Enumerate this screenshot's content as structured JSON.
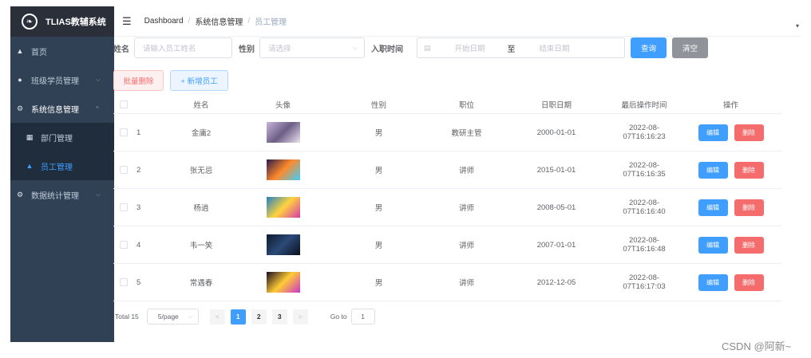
{
  "brand": {
    "title": "TLIAS教辅系统",
    "logo_icon": "leaf-logo"
  },
  "sidebar": {
    "items": [
      {
        "label": "首页",
        "icon": "home-icon",
        "glyph": "▲"
      },
      {
        "label": "班级学员管理",
        "icon": "settings-icon",
        "glyph": "●",
        "expandable": true
      },
      {
        "label": "系统信息管理",
        "icon": "gear-icon",
        "glyph": "⚙",
        "expandable": true,
        "open": true
      },
      {
        "label": "数据统计管理",
        "icon": "gear-icon",
        "glyph": "⚙",
        "expandable": true
      }
    ],
    "subitems": [
      {
        "label": "部门管理",
        "icon": "grid-icon",
        "glyph": "▦"
      },
      {
        "label": "员工管理",
        "icon": "user-icon",
        "glyph": "▲",
        "active": true
      }
    ],
    "chevron_down": "⌵",
    "chevron_up": "^"
  },
  "header": {
    "menu_glyph": "☰",
    "breadcrumb": [
      "Dashboard",
      "系统信息管理",
      "员工管理"
    ],
    "separator": "/",
    "caret": "▾"
  },
  "search": {
    "name_label": "姓名",
    "name_placeholder": "请输入员工姓名",
    "gender_label": "性别",
    "gender_placeholder": "请选择",
    "entry_label": "入职时间",
    "start_placeholder": "开始日期",
    "range_sep": "至",
    "end_placeholder": "结束日期",
    "query_button": "查询",
    "clear_button": "清空",
    "caret": "⌵",
    "calendar_glyph": "▤"
  },
  "actions": {
    "batch_delete": "批量删除",
    "add_employee": "+ 新增员工"
  },
  "table": {
    "headers": [
      "姓名",
      "头像",
      "性别",
      "职位",
      "日职日期",
      "最后操作时间",
      "操作"
    ],
    "rows": [
      {
        "index": "1",
        "name": "金庸2",
        "gender": "男",
        "job": "教研主管",
        "entry_date": "2000-01-01",
        "update_time": "2022-08-07T16:16:23",
        "img_colors": [
          "#c9b4d8",
          "#6c5e86",
          "#eae2ef"
        ]
      },
      {
        "index": "2",
        "name": "张无忌",
        "gender": "男",
        "job": "讲师",
        "entry_date": "2015-01-01",
        "update_time": "2022-08-07T16:16:35",
        "img_colors": [
          "#2a1a4a",
          "#ff8a2a",
          "#3ad0ff"
        ]
      },
      {
        "index": "3",
        "name": "杨逍",
        "gender": "男",
        "job": "讲师",
        "entry_date": "2008-05-01",
        "update_time": "2022-08-07T16:16:40",
        "img_colors": [
          "#1f7fc4",
          "#ffd33d",
          "#d63aa8"
        ]
      },
      {
        "index": "4",
        "name": "韦一笑",
        "gender": "男",
        "job": "讲师",
        "entry_date": "2007-01-01",
        "update_time": "2022-08-07T16:16:48",
        "img_colors": [
          "#0e1a2e",
          "#2c4a78",
          "#0a0f1c"
        ]
      },
      {
        "index": "5",
        "name": "常遇春",
        "gender": "男",
        "job": "讲师",
        "entry_date": "2012-12-05",
        "update_time": "2022-08-07T16:17:03",
        "img_colors": [
          "#1a0a22",
          "#ffcc33",
          "#cc33cc"
        ]
      }
    ],
    "edit_label": "编辑",
    "delete_label": "删除"
  },
  "pagination": {
    "total": "Total 15",
    "page_size": "5/page",
    "pages": [
      "1",
      "2",
      "3"
    ],
    "current": "1",
    "prev": "<",
    "next": ">",
    "goto_label": "Go to",
    "goto_value": "1",
    "caret": "⌵"
  },
  "watermark": "CSDN @阿新~",
  "colors": {
    "sidebar_bg": "#304156",
    "primary": "#409eff",
    "danger": "#f56c6c",
    "active": "#409eff"
  }
}
